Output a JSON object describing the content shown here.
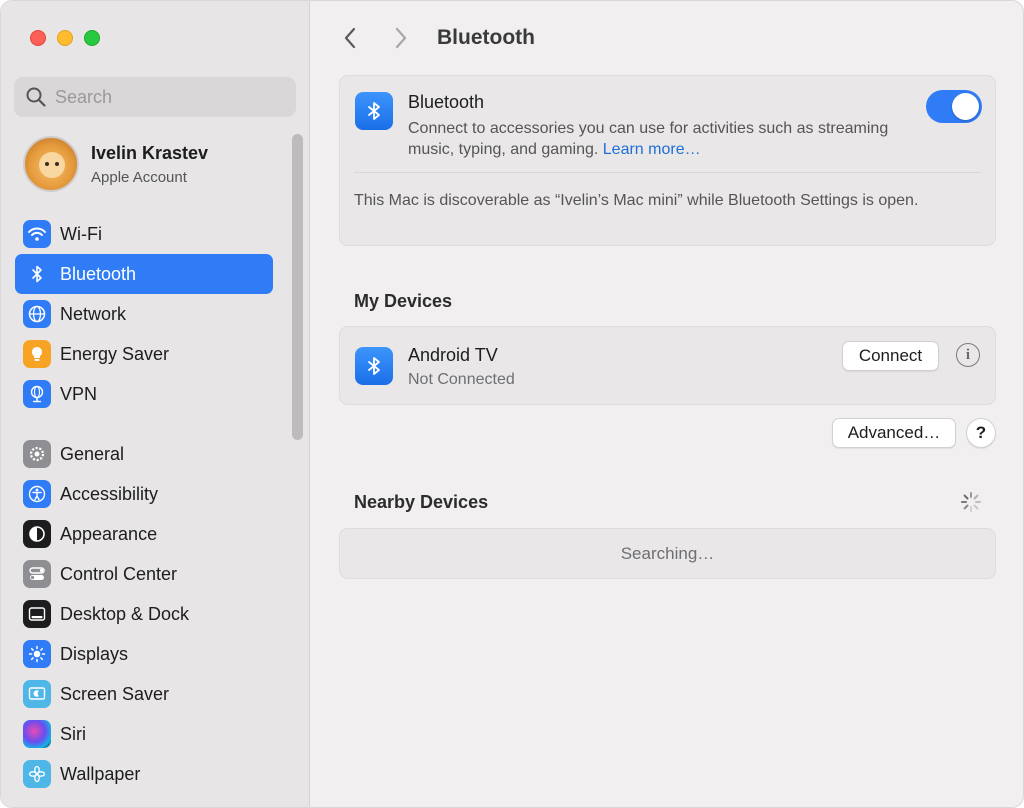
{
  "window": {
    "controls": [
      "close",
      "minimize",
      "zoom"
    ]
  },
  "sidebar": {
    "search": {
      "placeholder": "Search",
      "icon": "magnifying-glass-icon"
    },
    "account": {
      "name": "Ivelin Krastev",
      "subtitle": "Apple Account",
      "avatar": "lion-memoji"
    },
    "group1": [
      {
        "label": "Wi-Fi",
        "icon": "wifi-icon",
        "color": "#2f7cf6"
      },
      {
        "label": "Bluetooth",
        "icon": "bluetooth-icon",
        "color": "#2f7cf6",
        "active": true
      },
      {
        "label": "Network",
        "icon": "globe-icon",
        "color": "#2f7cf6"
      },
      {
        "label": "Energy Saver",
        "icon": "lightbulb-icon",
        "color": "#f7a425"
      },
      {
        "label": "VPN",
        "icon": "vpn-globe-icon",
        "color": "#2f7cf6"
      }
    ],
    "group2": [
      {
        "label": "General",
        "icon": "gear-icon",
        "color": "#8e8e93"
      },
      {
        "label": "Accessibility",
        "icon": "accessibility-icon",
        "color": "#2f7cf6"
      },
      {
        "label": "Appearance",
        "icon": "appearance-icon",
        "color": "#1d1d1f"
      },
      {
        "label": "Control Center",
        "icon": "control-center-icon",
        "color": "#8e8e93"
      },
      {
        "label": "Desktop & Dock",
        "icon": "dock-icon",
        "color": "#1d1d1f"
      },
      {
        "label": "Displays",
        "icon": "sun-icon",
        "color": "#2f7cf6"
      },
      {
        "label": "Screen Saver",
        "icon": "screen-saver-icon",
        "color": "#4fb6e8"
      },
      {
        "label": "Siri",
        "icon": "siri-icon",
        "color": "#1d1d1f"
      },
      {
        "label": "Wallpaper",
        "icon": "flower-icon",
        "color": "#4fb6e8"
      }
    ]
  },
  "toolbar": {
    "back_icon": "chevron-left-icon",
    "forward_icon": "chevron-right-icon",
    "title": "Bluetooth"
  },
  "bluetooth": {
    "title": "Bluetooth",
    "description": "Connect to accessories you can use for activities such as streaming music, typing, and gaming.",
    "learn_more": "Learn more…",
    "enabled": true,
    "discoverable": "This Mac is discoverable as “Ivelin’s Mac mini” while Bluetooth Settings is open."
  },
  "my_devices": {
    "heading": "My Devices",
    "devices": [
      {
        "name": "Android TV",
        "status": "Not Connected",
        "action": "Connect"
      }
    ]
  },
  "buttons": {
    "advanced": "Advanced…",
    "help": "?"
  },
  "nearby": {
    "heading": "Nearby Devices",
    "status": "Searching…"
  },
  "colors": {
    "accent": "#2f7cf6",
    "link": "#1f6fd6"
  }
}
